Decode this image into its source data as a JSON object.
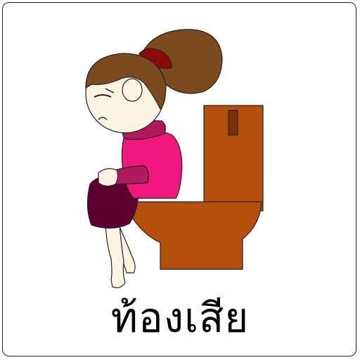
{
  "card": {
    "caption": "ท้องเสีย"
  },
  "colors": {
    "toilet": "#B4500C",
    "toilet_button": "#7A3008",
    "hair": "#7B4A1E",
    "hair_tie": "#8B0A0A",
    "skin": "#FBF2E2",
    "shirt": "#F2177C",
    "scarf": "#B0195A",
    "shorts": "#5E0030",
    "outline": "#222222"
  },
  "icons": {
    "illustration": "girl-on-toilet-icon"
  }
}
